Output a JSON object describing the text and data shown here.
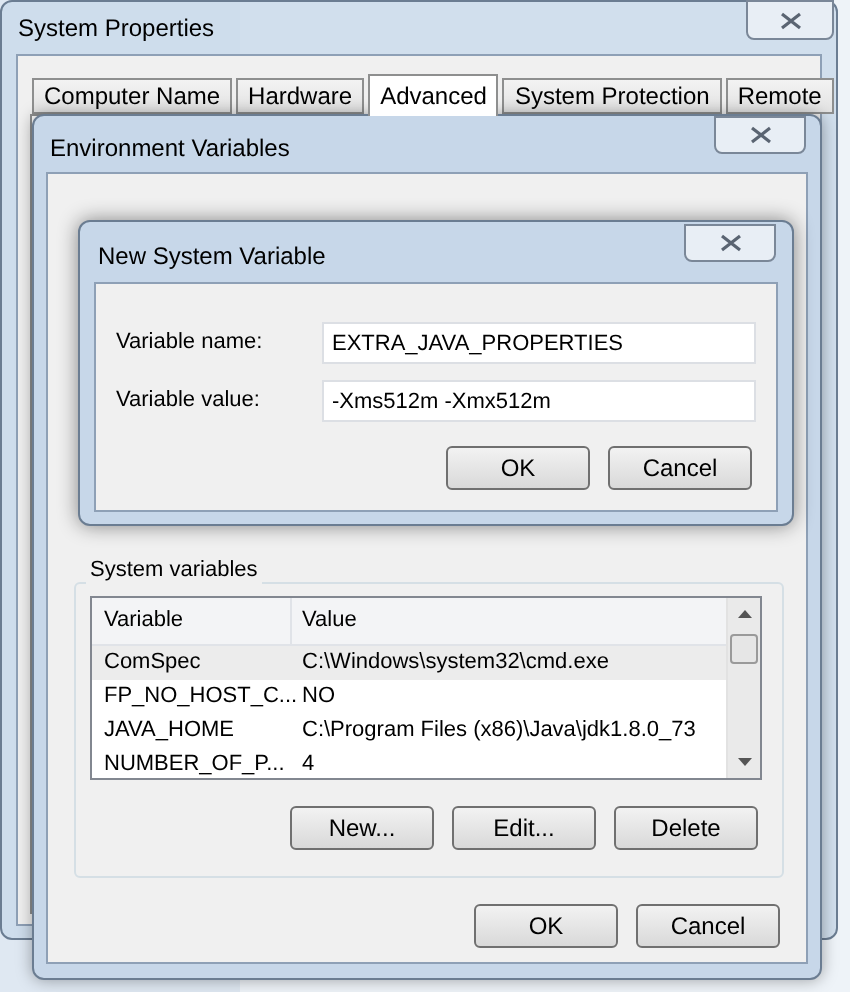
{
  "system_properties": {
    "title": "System Properties",
    "tabs": [
      {
        "label": "Computer Name",
        "selected": false
      },
      {
        "label": "Hardware",
        "selected": false
      },
      {
        "label": "Advanced",
        "selected": true
      },
      {
        "label": "System Protection",
        "selected": false
      },
      {
        "label": "Remote",
        "selected": false
      }
    ]
  },
  "environment_variables": {
    "title": "Environment Variables",
    "system_variables": {
      "label": "System variables",
      "columns": [
        "Variable",
        "Value"
      ],
      "rows": [
        {
          "variable": "ComSpec",
          "value": "C:\\Windows\\system32\\cmd.exe",
          "selected": true
        },
        {
          "variable": "FP_NO_HOST_C...",
          "value": "NO",
          "selected": false
        },
        {
          "variable": "JAVA_HOME",
          "value": "C:\\Program Files (x86)\\Java\\jdk1.8.0_73",
          "selected": false
        },
        {
          "variable": "NUMBER_OF_P...",
          "value": "4",
          "selected": false
        }
      ],
      "buttons": [
        "New...",
        "Edit...",
        "Delete"
      ]
    },
    "buttons": [
      "OK",
      "Cancel"
    ]
  },
  "new_system_variable": {
    "title": "New System Variable",
    "fields": [
      {
        "label": "Variable name:",
        "value": "EXTRA_JAVA_PROPERTIES"
      },
      {
        "label": "Variable value:",
        "value": "-Xms512m -Xmx512m"
      }
    ],
    "buttons": [
      "OK",
      "Cancel"
    ]
  }
}
